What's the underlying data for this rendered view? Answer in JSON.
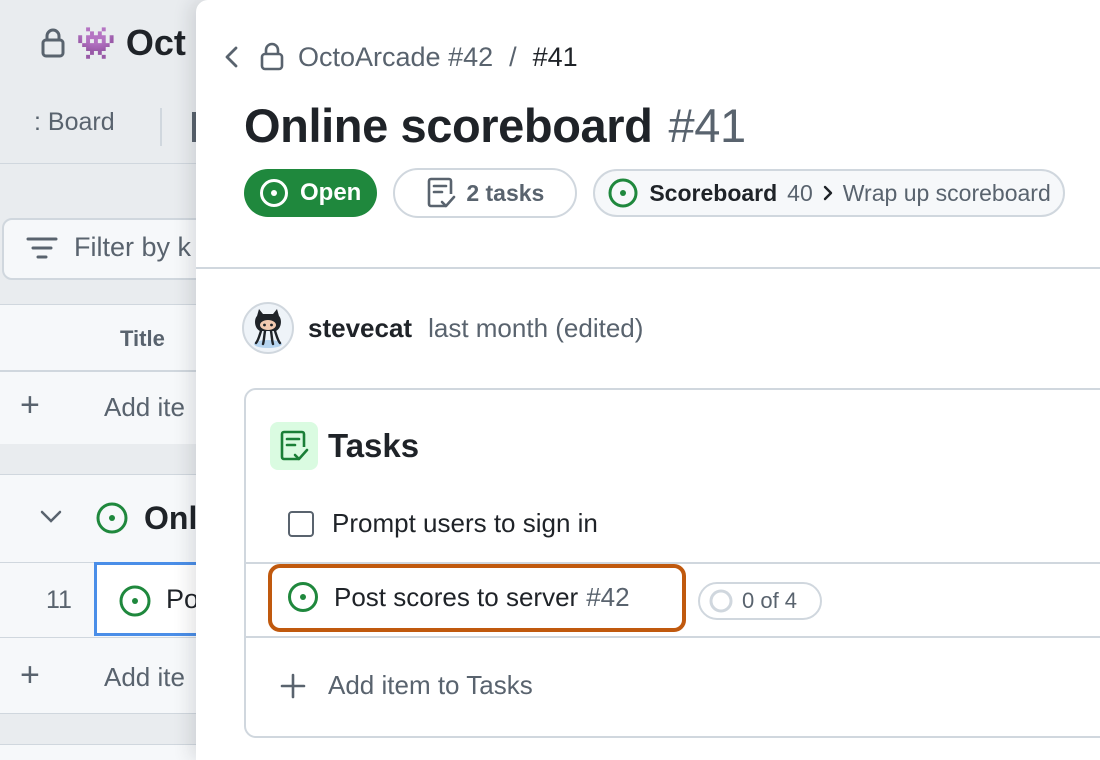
{
  "board": {
    "title_partial": "Oct",
    "tab_label_partial": "Board",
    "filter_placeholder_partial": "Filter by k",
    "column_title": "Title",
    "add_item_partial": "Add ite",
    "group_title_partial": "Onl",
    "row_number": "11",
    "row_title_partial": "Po",
    "add_item_partial_2": "Add ite"
  },
  "panel": {
    "breadcrumb": {
      "repo": "OctoArcade #42",
      "separator": "/",
      "current": "#41"
    },
    "title": "Online scoreboard",
    "number": "#41",
    "state_badge": "Open",
    "tasks_badge": "2 tasks",
    "parent": {
      "name": "Scoreboard",
      "number": "40",
      "sub": "Wrap up scoreboard"
    },
    "author": {
      "username": "stevecat",
      "timestamp": "last month (edited)"
    },
    "tasklist": {
      "title": "Tasks",
      "items": [
        {
          "label": "Prompt users to sign in",
          "checked": false
        },
        {
          "label": "Post scores to server",
          "number": "#42",
          "progress": "0 of 4"
        }
      ],
      "add_label": "Add item to Tasks"
    }
  },
  "colors": {
    "open_green": "#1f883d",
    "highlight_orange": "#c0590e",
    "muted_text": "#59636e",
    "border": "#d0d7de",
    "selected_cell_blue": "#4a8ee8"
  },
  "icons": [
    "lock-icon",
    "alien-emoji-icon",
    "filter-icon",
    "plus-icon",
    "chevron-down-icon",
    "issue-open-icon",
    "chevron-left-icon",
    "tasklist-icon",
    "chevron-right-icon",
    "octocat-avatar",
    "progress-circle-icon"
  ]
}
